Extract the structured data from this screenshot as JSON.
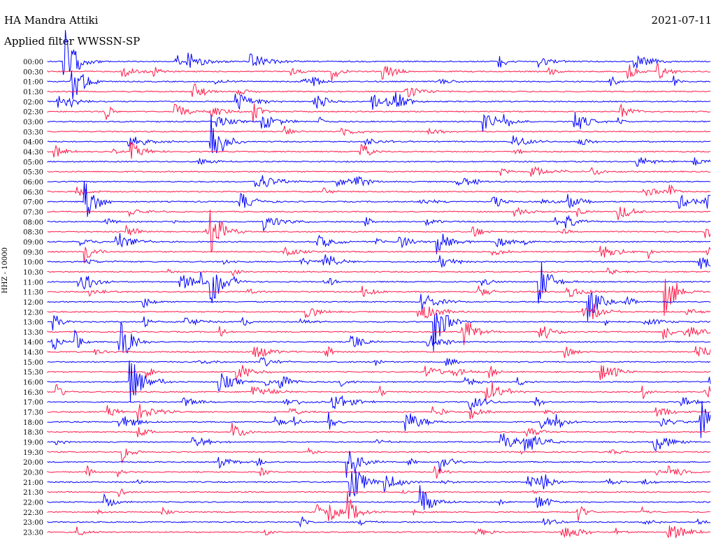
{
  "header": {
    "station": "HA Mandra Attiki",
    "filter": "Applied filter WWSSN-SP",
    "date": "2021-07-11"
  },
  "channel_label": "HHZ - 10000",
  "colors": {
    "even_trace": "#0000ff",
    "odd_trace": "#ff1a4a"
  },
  "chart_data": {
    "type": "line",
    "title": "HA Mandra Attiki",
    "subtitle": "Applied filter WWSSN-SP",
    "ylabel": "HHZ - 10000",
    "rows": [
      "00:00",
      "00:30",
      "01:00",
      "01:30",
      "02:00",
      "02:30",
      "03:00",
      "03:30",
      "04:00",
      "04:30",
      "05:00",
      "05:30",
      "06:00",
      "06:30",
      "07:00",
      "07:30",
      "08:00",
      "08:30",
      "09:00",
      "09:30",
      "10:00",
      "10:30",
      "11:00",
      "11:30",
      "12:00",
      "12:30",
      "13:00",
      "13:30",
      "14:00",
      "14:30",
      "15:00",
      "15:30",
      "16:00",
      "16:30",
      "17:00",
      "17:30",
      "18:00",
      "18:30",
      "19:00",
      "19:30",
      "20:00",
      "20:30",
      "21:00",
      "21:30",
      "22:00",
      "22:30",
      "23:00",
      "23:30"
    ],
    "row_minutes": 30,
    "color_cycle": [
      "blue",
      "red"
    ]
  }
}
